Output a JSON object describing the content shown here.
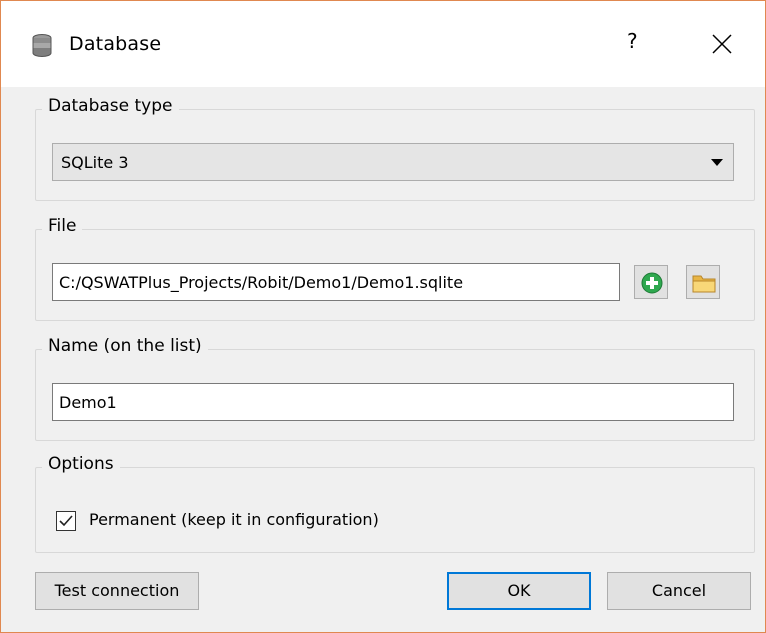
{
  "window": {
    "title": "Database",
    "help_label": "?",
    "icon": "database-icon",
    "close_icon": "close-icon"
  },
  "database_type": {
    "legend": "Database type",
    "selected": "SQLite 3"
  },
  "file": {
    "legend": "File",
    "path": "C:/QSWATPlus_Projects/Robit/Demo1/Demo1.sqlite",
    "new_icon": "add-icon",
    "browse_icon": "folder-icon"
  },
  "name": {
    "legend": "Name (on the list)",
    "value": "Demo1"
  },
  "options": {
    "legend": "Options",
    "permanent_label": "Permanent (keep it in configuration)",
    "permanent_checked": true
  },
  "buttons": {
    "test_connection": "Test connection",
    "ok": "OK",
    "cancel": "Cancel"
  },
  "colors": {
    "accent": "#0078d7",
    "window_border": "#e08850",
    "add_icon": "#2fa84f",
    "folder_icon": "#f5c55b"
  }
}
